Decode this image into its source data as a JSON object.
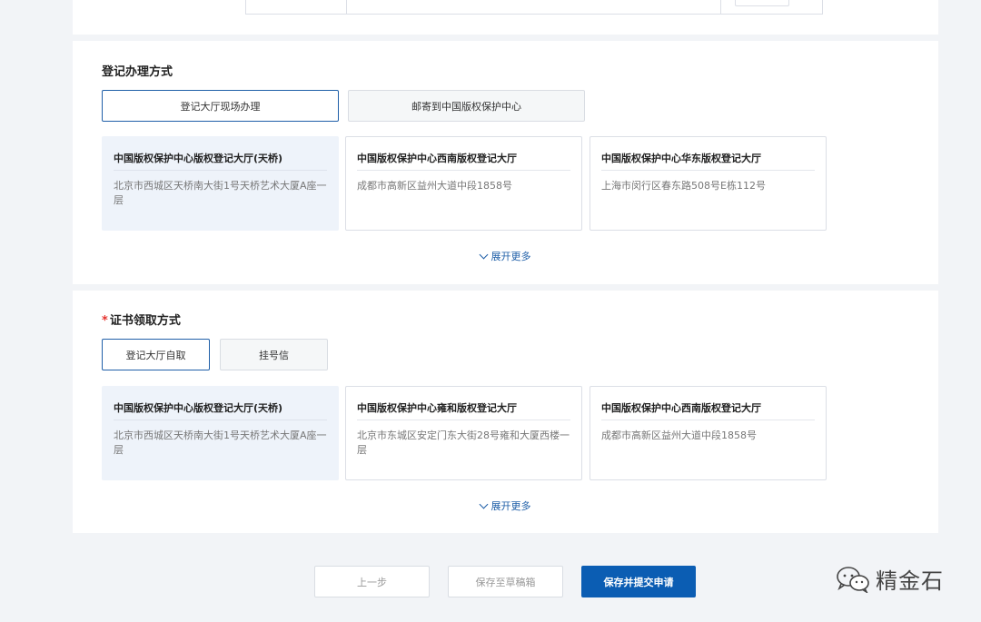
{
  "registration": {
    "title": "登记办理方式",
    "options": [
      "登记大厅现场办理",
      "邮寄到中国版权保护中心"
    ],
    "cards": [
      {
        "name": "中国版权保护中心版权登记大厅(天桥)",
        "address": "北京市西城区天桥南大街1号天桥艺术大厦A座一层"
      },
      {
        "name": "中国版权保护中心西南版权登记大厅",
        "address": "成都市高新区益州大道中段1858号"
      },
      {
        "name": "中国版权保护中心华东版权登记大厅",
        "address": "上海市闵行区春东路508号E栋112号"
      }
    ],
    "expand": "展开更多"
  },
  "certificate": {
    "required_mark": "*",
    "title": "证书领取方式",
    "options": [
      "登记大厅自取",
      "挂号信"
    ],
    "cards": [
      {
        "name": "中国版权保护中心版权登记大厅(天桥)",
        "address": "北京市西城区天桥南大街1号天桥艺术大厦A座一层"
      },
      {
        "name": "中国版权保护中心雍和版权登记大厅",
        "address": "北京市东城区安定门东大街28号雍和大厦西楼一层"
      },
      {
        "name": "中国版权保护中心西南版权登记大厅",
        "address": "成都市高新区益州大道中段1858号"
      }
    ],
    "expand": "展开更多"
  },
  "footer": {
    "prev": "上一步",
    "save_draft": "保存至草稿箱",
    "submit": "保存并提交申请"
  },
  "watermark": {
    "text": "精金石",
    "icon": "wechat-icon"
  },
  "colors": {
    "primary": "#0b5db3",
    "required": "#e5322d",
    "selected_card_bg": "#eef3fa"
  }
}
